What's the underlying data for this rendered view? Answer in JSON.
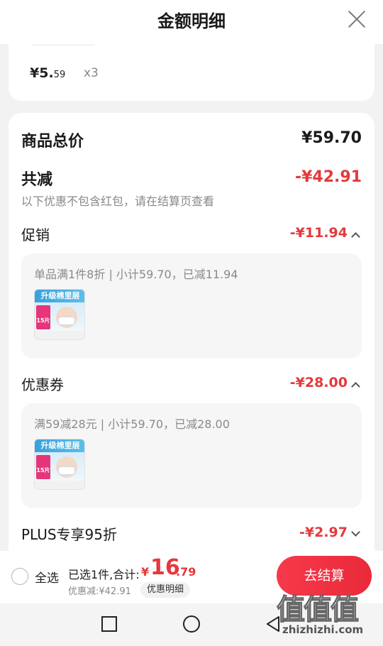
{
  "header": {
    "title": "金额明细"
  },
  "item_card": {
    "price_main": "¥5.",
    "price_cents": "59",
    "quantity": "x3"
  },
  "summary": {
    "total_label": "商品总价",
    "total_value": "¥59.70",
    "reduction_label": "共减",
    "reduction_value": "-¥42.91",
    "note": "以下优惠不包含红包，请在结算页查看"
  },
  "sections": [
    {
      "title": "促销",
      "value": "-¥11.94",
      "expanded": true,
      "desc": "单品满1件8折 | 小计59.70，已减11.94",
      "image": {
        "tag": "升级棉里层",
        "badge": "15片"
      }
    },
    {
      "title": "优惠券",
      "value": "-¥28.00",
      "expanded": true,
      "desc": "满59减28元 | 小计59.70，已减28.00",
      "image": {
        "tag": "升级棉里层",
        "badge": "15片"
      }
    },
    {
      "title": "PLUS专享95折",
      "value": "-¥2.97",
      "expanded": false
    }
  ],
  "bottom_bar": {
    "select_all": "全选",
    "selected_text": "已选1件,合计:",
    "total_symbol": "¥",
    "total_int": "16",
    "total_dec": ".79",
    "discount_text": "优惠减:¥42.91",
    "detail_chip": "优惠明细",
    "checkout": "去结算"
  },
  "watermark": {
    "chars": "值值值",
    "url": "zhizhizhi.com"
  },
  "colors": {
    "accent_red": "#e4393c",
    "checkout_red": "#f6394b"
  }
}
